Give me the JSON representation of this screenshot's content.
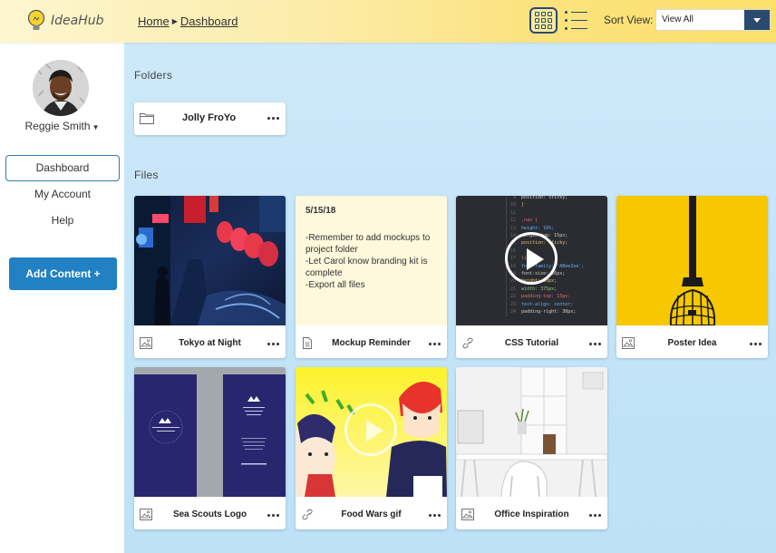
{
  "app": {
    "name": "IdeaHub"
  },
  "breadcrumb": {
    "home": "Home",
    "current": "Dashboard"
  },
  "toolbar": {
    "sort_label": "Sort View:",
    "sort_value": "View All"
  },
  "user": {
    "name": "Reggie Smith"
  },
  "nav": {
    "dashboard": "Dashboard",
    "account": "My Account",
    "help": "Help"
  },
  "add_button": "Add Content +",
  "folders": {
    "heading": "Folders",
    "items": [
      {
        "name": "Jolly FroYo"
      }
    ]
  },
  "files": {
    "heading": "Files",
    "items": [
      {
        "title": "Tokyo at Night",
        "type": "image"
      },
      {
        "title": "Mockup Reminder",
        "type": "document",
        "date": "5/15/18",
        "note_lines": [
          "-Remember to add mockups to project folder",
          "-Let Carol know branding kit is complete",
          "-Export all files"
        ]
      },
      {
        "title": "CSS Tutorial",
        "type": "link"
      },
      {
        "title": "Poster Idea",
        "type": "image"
      },
      {
        "title": "Sea Scouts Logo",
        "type": "image"
      },
      {
        "title": "Food Wars gif",
        "type": "link"
      },
      {
        "title": "Office Inspiration",
        "type": "image"
      }
    ]
  },
  "code_snippet": [
    "position: sticky;",
    "}",
    "",
    ".nav {",
    "height: 10%;",
    "margin-top: 15px;",
    "position: sticky;",
    "",
    "li {",
    "font-family: 'ABeeZee';",
    "font-size: 26px;",
    "height: 60px;",
    "width: 375px;",
    "padding-top: 15px;",
    "text-align: center;",
    "padding-right: 30px;"
  ],
  "colors": {
    "accent_blue": "#2181c3",
    "nav_dark": "#2b4a6f",
    "memo_bg": "#fef8dd",
    "poster_yellow": "#f7c700"
  }
}
